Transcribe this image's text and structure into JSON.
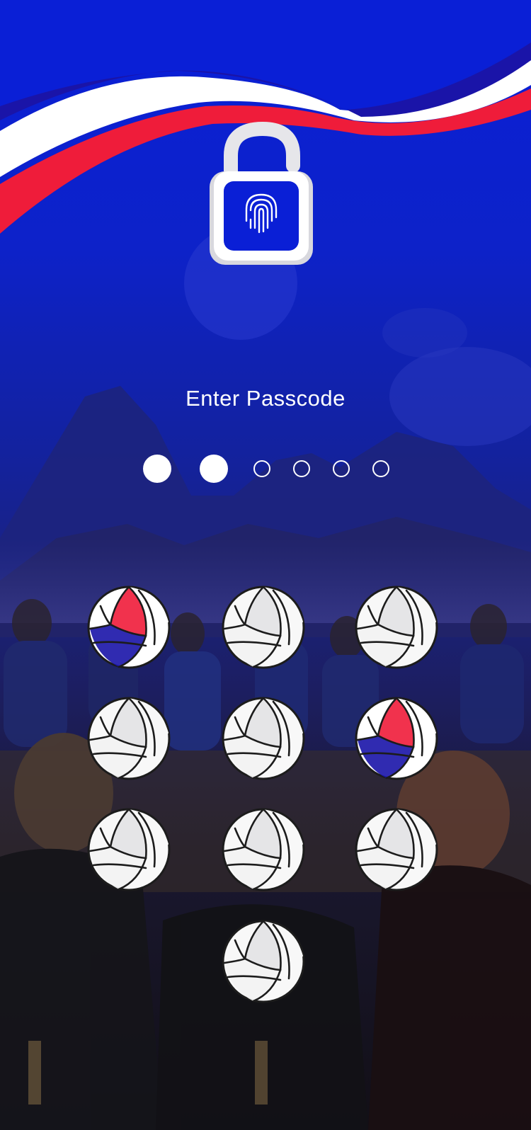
{
  "screen": {
    "title": "Enter Passcode"
  },
  "passcode": {
    "length": 6,
    "entered": 2
  },
  "keypad": {
    "keys": [
      {
        "id": "1",
        "style": "tricolor"
      },
      {
        "id": "2",
        "style": "white"
      },
      {
        "id": "3",
        "style": "white"
      },
      {
        "id": "4",
        "style": "white"
      },
      {
        "id": "5",
        "style": "white"
      },
      {
        "id": "6",
        "style": "tricolor"
      },
      {
        "id": "7",
        "style": "white"
      },
      {
        "id": "8",
        "style": "white"
      },
      {
        "id": "9",
        "style": "white"
      },
      {
        "id": "0",
        "style": "white"
      }
    ]
  },
  "colors": {
    "background_top": "#0a1fd6",
    "flag_red": "#ef1c3a",
    "flag_white": "#ffffff",
    "flag_blue": "#1a14a8",
    "dot": "#ffffff"
  },
  "icons": {
    "lock": "unlocked-padlock-icon",
    "fingerprint": "fingerprint-icon",
    "key": "volleyball-icon"
  }
}
